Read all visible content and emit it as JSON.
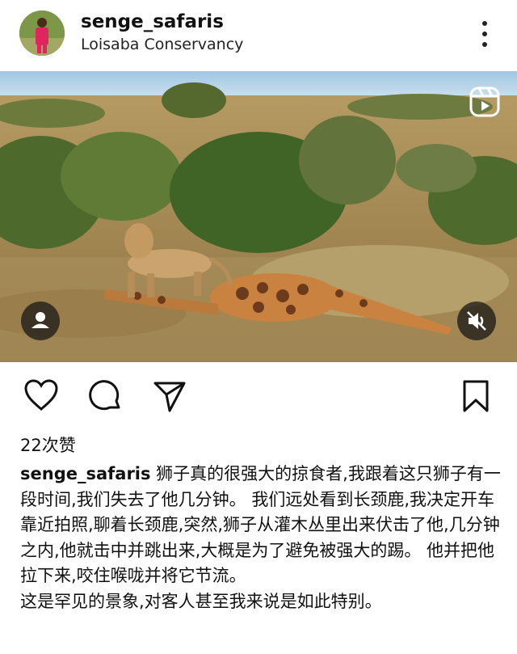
{
  "post": {
    "username": "senge_safaris",
    "location": "Loisaba Conservancy",
    "likes": "22次赞",
    "caption_user": "senge_safaris",
    "caption_body": " 狮子真的很强大的掠食者,我跟着这只狮子有一段时间,我们失去了他几分钟。 我们远处看到长颈鹿,我决定开车靠近拍照,聊着长颈鹿,突然,狮子从灌木丛里出来伏击了他,几分钟之内,他就击中并跳出来,大概是为了避免被强大的踢。 他并把他拉下来,咬住喉咙并将它节流。",
    "caption_line2": "这是罕见的景象,对客人甚至我来说是如此特别。"
  },
  "icons": {
    "more": "more-vertical-icon",
    "reels": "reels-icon",
    "tag": "user-tag-icon",
    "mute": "volume-muted-icon",
    "like": "heart-icon",
    "comment": "comment-bubble-icon",
    "share": "send-icon",
    "save": "bookmark-icon"
  },
  "colors": {
    "text": "#111111",
    "overlay": "#141414"
  }
}
